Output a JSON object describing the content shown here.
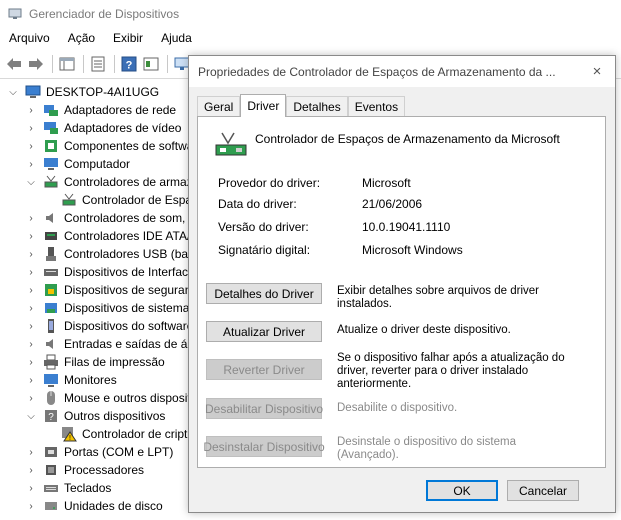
{
  "window": {
    "title": "Gerenciador de Dispositivos"
  },
  "menu": [
    "Arquivo",
    "Ação",
    "Exibir",
    "Ajuda"
  ],
  "tree": {
    "root": "DESKTOP-4AI1UGG",
    "items": [
      {
        "label": "Adaptadores de rede",
        "icon": "network-adapter-icon",
        "expanded": false
      },
      {
        "label": "Adaptadores de vídeo",
        "icon": "display-adapter-icon",
        "expanded": false
      },
      {
        "label": "Componentes de softwa",
        "icon": "software-component-icon",
        "expanded": false
      },
      {
        "label": "Computador",
        "icon": "computer-icon",
        "expanded": false
      },
      {
        "label": "Controladores de armaz",
        "icon": "storage-controller-icon",
        "expanded": true
      },
      {
        "label": "Controlador de Espa",
        "icon": "storage-controller-icon",
        "child": true
      },
      {
        "label": "Controladores de som, v",
        "icon": "sound-icon",
        "expanded": false
      },
      {
        "label": "Controladores IDE ATA/A",
        "icon": "ide-icon",
        "expanded": false
      },
      {
        "label": "Controladores USB (barr",
        "icon": "usb-icon",
        "expanded": false
      },
      {
        "label": "Dispositivos de Interface",
        "icon": "hid-icon",
        "expanded": false
      },
      {
        "label": "Dispositivos de seguranç",
        "icon": "security-device-icon",
        "expanded": false
      },
      {
        "label": "Dispositivos de sistema",
        "icon": "system-device-icon",
        "expanded": false
      },
      {
        "label": "Dispositivos do software",
        "icon": "software-device-icon",
        "expanded": false
      },
      {
        "label": "Entradas e saídas de áuc",
        "icon": "audio-io-icon",
        "expanded": false
      },
      {
        "label": "Filas de impressão",
        "icon": "printer-icon",
        "expanded": false
      },
      {
        "label": "Monitores",
        "icon": "monitor-icon",
        "expanded": false
      },
      {
        "label": "Mouse e outros disposit",
        "icon": "mouse-icon",
        "expanded": false
      },
      {
        "label": "Outros dispositivos",
        "icon": "other-devices-icon",
        "expanded": true
      },
      {
        "label": "Controlador de cript",
        "icon": "warning-device-icon",
        "child": true
      },
      {
        "label": "Portas (COM e LPT)",
        "icon": "port-icon",
        "expanded": false
      },
      {
        "label": "Processadores",
        "icon": "processor-icon",
        "expanded": false
      },
      {
        "label": "Teclados",
        "icon": "keyboard-icon",
        "expanded": false
      },
      {
        "label": "Unidades de disco",
        "icon": "disk-drive-icon",
        "expanded": false
      }
    ]
  },
  "dialog": {
    "title": "Propriedades de Controlador de Espaços de Armazenamento da ...",
    "tabs": [
      "Geral",
      "Driver",
      "Detalhes",
      "Eventos"
    ],
    "active_tab": "Driver",
    "device_name": "Controlador de Espaços de Armazenamento da Microsoft",
    "properties": [
      {
        "label": "Provedor do driver:",
        "value": "Microsoft"
      },
      {
        "label": "Data do driver:",
        "value": "21/06/2006"
      },
      {
        "label": "Versão do driver:",
        "value": "10.0.19041.1110"
      },
      {
        "label": "Signatário digital:",
        "value": "Microsoft Windows"
      }
    ],
    "actions": [
      {
        "label": "Detalhes do Driver",
        "desc": "Exibir detalhes sobre arquivos de driver instalados.",
        "enabled": true
      },
      {
        "label": "Atualizar Driver",
        "desc": "Atualize o driver deste dispositivo.",
        "enabled": true
      },
      {
        "label": "Reverter Driver",
        "desc": "Se o dispositivo falhar após a atualização do driver, reverter para o driver instalado anteriormente.",
        "enabled": false
      },
      {
        "label": "Desabilitar Dispositivo",
        "desc": "Desabilite o dispositivo.",
        "enabled": false
      },
      {
        "label": "Desinstalar Dispositivo",
        "desc": "Desinstale o dispositivo do sistema (Avançado).",
        "enabled": false
      }
    ],
    "ok": "OK",
    "cancel": "Cancelar",
    "close_icon": "×"
  }
}
